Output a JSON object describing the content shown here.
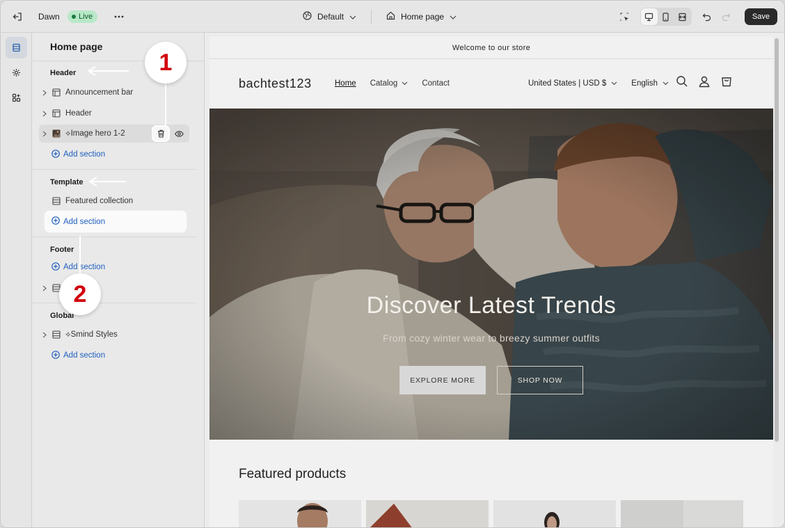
{
  "topbar": {
    "theme_name": "Dawn",
    "status_badge": "Live",
    "theme_select": "Default",
    "page_select": "Home page",
    "save_label": "Save"
  },
  "sidebar": {
    "title": "Home page",
    "groups": {
      "header": {
        "label": "Header",
        "items": [
          "Announcement bar",
          "Header",
          "⟡Image hero 1-2"
        ],
        "add_label": "Add section"
      },
      "template": {
        "label": "Template",
        "items": [
          "Featured collection"
        ],
        "add_label": "Add section"
      },
      "footer": {
        "label": "Footer",
        "add_label": "Add section"
      },
      "global": {
        "label": "Global",
        "items": [
          "⟡Smind Styles"
        ],
        "add_label": "Add section"
      }
    }
  },
  "preview": {
    "announcement": "Welcome to our store",
    "store_name": "bachtest123",
    "nav": [
      "Home",
      "Catalog",
      "Contact"
    ],
    "country_currency": "United States | USD $",
    "language": "English",
    "hero": {
      "title": "Discover Latest Trends",
      "subtitle": "From cozy winter wear to breezy summer outfits",
      "button_primary": "EXPLORE MORE",
      "button_secondary": "SHOP NOW"
    },
    "featured_title": "Featured products"
  },
  "callouts": [
    "1",
    "2"
  ],
  "icons": [
    "exit-icon",
    "more-icon",
    "theme-globe-icon",
    "home-icon",
    "chevron-down-icon",
    "inspector-icon",
    "desktop-icon",
    "mobile-icon",
    "fullwidth-icon",
    "undo-icon",
    "redo-icon",
    "sections-icon",
    "settings-gear-icon",
    "apps-icon",
    "chevron-right-icon",
    "section-layout-icon",
    "image-thumb-icon",
    "trash-icon",
    "eye-icon",
    "add-circle-icon",
    "search-icon",
    "account-icon",
    "cart-icon"
  ],
  "colors": {
    "accent_link": "#1f5fbf",
    "callout_red": "#d1000f",
    "live_badge_bg": "#b8e8c8",
    "save_bg": "#2a2a2a"
  }
}
